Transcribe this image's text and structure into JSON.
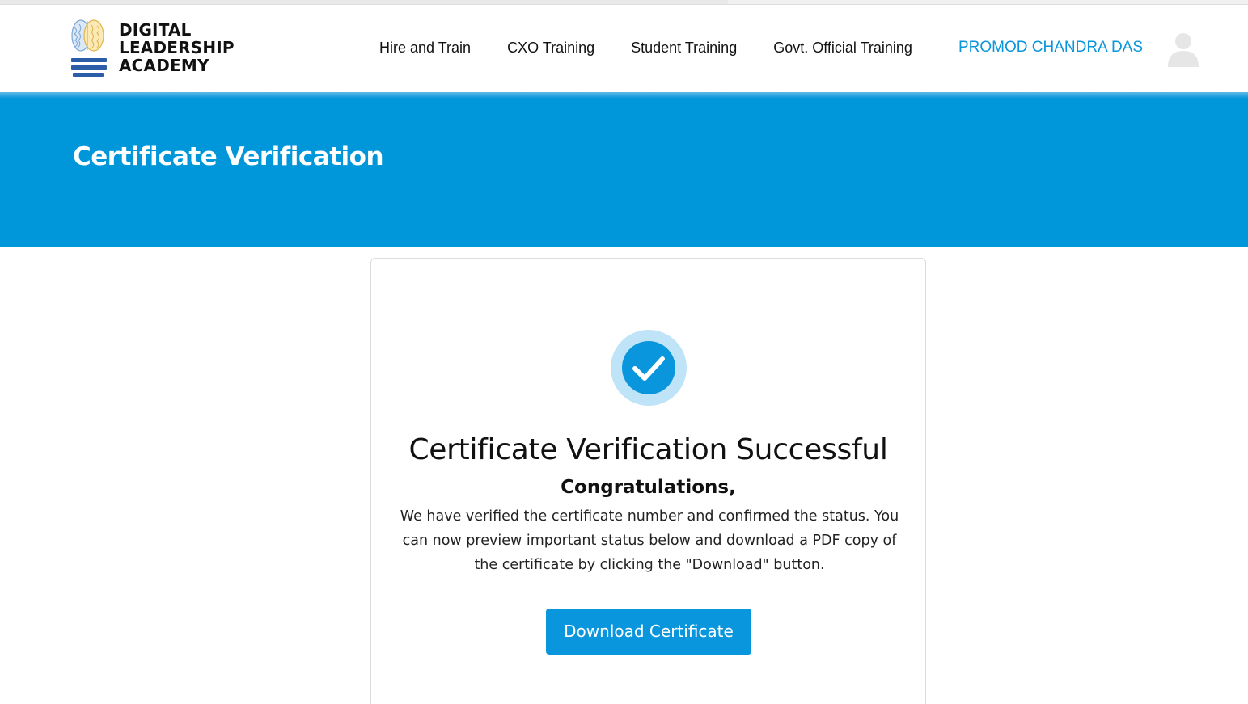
{
  "header": {
    "logo": {
      "line1": "DIGITAL",
      "line2": "LEADERSHIP",
      "line3": "ACADEMY",
      "icon": "brain-logo-icon"
    },
    "nav": [
      {
        "label": "Hire and Train"
      },
      {
        "label": "CXO Training"
      },
      {
        "label": "Student Training"
      },
      {
        "label": "Govt. Official Training"
      }
    ],
    "user_name": "PROMOD CHANDRA DAS",
    "avatar_icon": "user-avatar-icon"
  },
  "hero": {
    "title": "Certificate Verification"
  },
  "card": {
    "status_icon": "check-circle-icon",
    "title": "Certificate Verification Successful",
    "subtitle": "Congratulations,",
    "message": "We have verified the certificate number and confirmed the status. You can now preview important status below and download a PDF copy of the certificate by clicking the \"Download\" button.",
    "download_label": "Download Certificate"
  },
  "colors": {
    "brand_blue": "#0096da",
    "link_blue": "#0996dc",
    "check_ring": "#bfe3f7"
  }
}
